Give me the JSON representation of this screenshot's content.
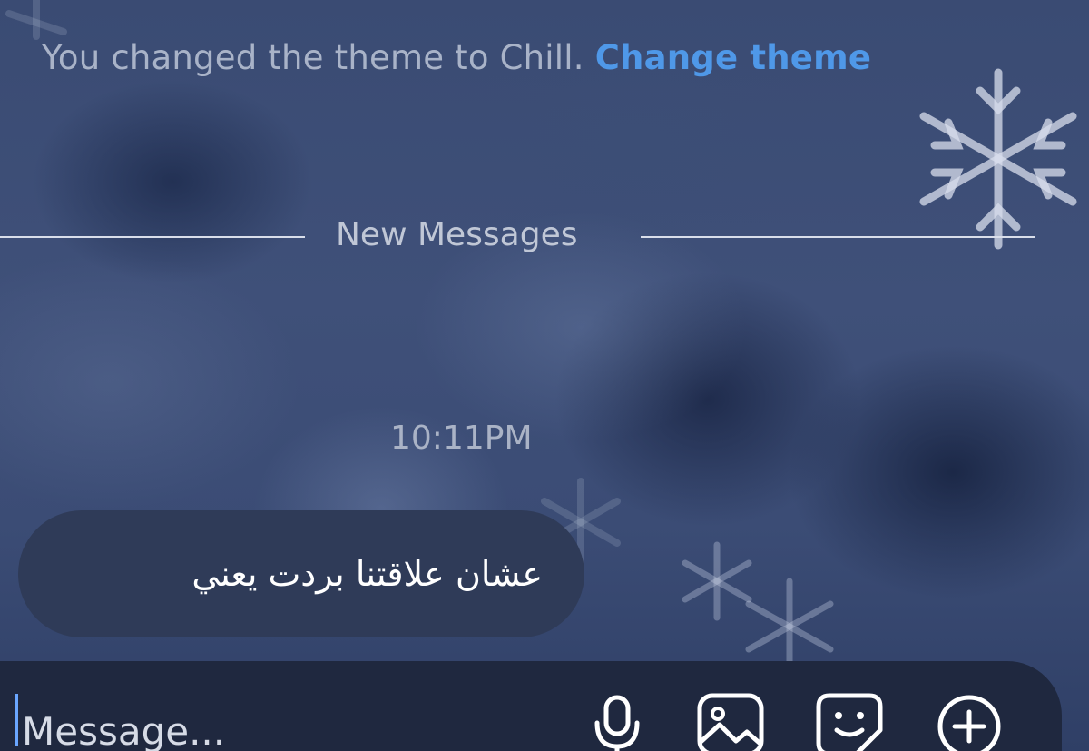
{
  "background": {
    "theme_colors": {
      "base": "#3b4c75",
      "snowflake": "#d8deec"
    }
  },
  "system_note": {
    "text": "You changed the theme to Chill.",
    "link_label": "Change theme",
    "link_color": "#4f98e8"
  },
  "divider": {
    "label": "New Messages"
  },
  "thread": {
    "timestamp": "10:11PM",
    "messages": [
      {
        "text": "عشان علاقتنا بردت يعني",
        "direction": "incoming"
      }
    ]
  },
  "composer": {
    "placeholder": "Message...",
    "value": "",
    "icons": [
      "microphone-icon",
      "gallery-icon",
      "sticker-icon",
      "add-icon"
    ]
  }
}
